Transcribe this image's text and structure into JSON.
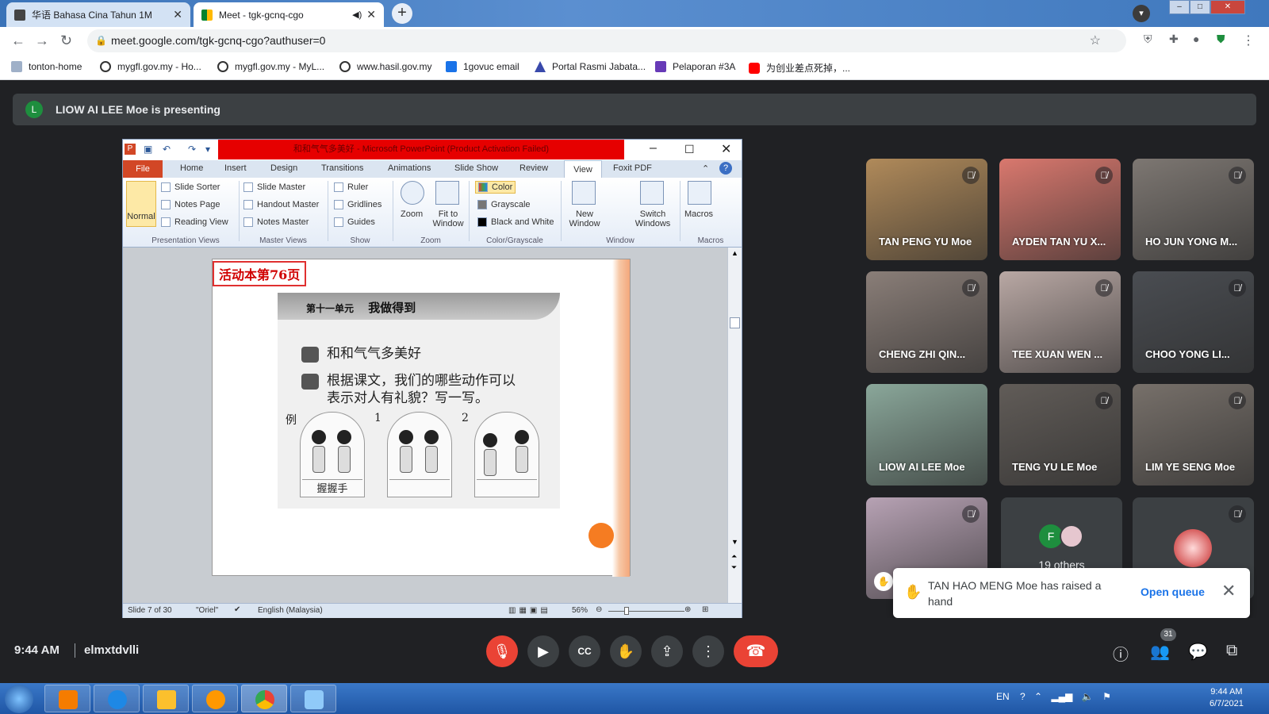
{
  "browser": {
    "tabs": [
      {
        "title": "华语 Bahasa Cina Tahun 1M",
        "active": false
      },
      {
        "title": "Meet - tgk-gcnq-cgo",
        "active": true
      }
    ],
    "url": "meet.google.com/tgk-gcnq-cgo?authuser=0",
    "bookmarks": [
      "tonton-home",
      "mygfl.gov.my - Ho...",
      "mygfl.gov.my - MyL...",
      "www.hasil.gov.my",
      "1govuc email",
      "Portal Rasmi Jabata...",
      "Pelaporan #3A",
      "为创业差点死掉，..."
    ]
  },
  "meet": {
    "presenter_initial": "L",
    "presenting_text": "LIOW AI LEE Moe is presenting",
    "time": "9:44 AM",
    "meeting_code": "elmxtdvlli",
    "participant_count": "31",
    "others_text": "19 others",
    "others_avatar": "F",
    "toast": {
      "message": "TAN HAO MENG Moe has raised a hand",
      "action": "Open queue"
    },
    "tiles": [
      {
        "name": "TAN PENG YU Moe",
        "color": "#b08a5a"
      },
      {
        "name": "AYDEN TAN YU X...",
        "color": "#d9786e"
      },
      {
        "name": "HO JUN YONG M...",
        "color": "#7d7772"
      },
      {
        "name": "CHENG ZHI QIN...",
        "color": "#8a7e78"
      },
      {
        "name": "TEE XUAN WEN ...",
        "color": "#b9a8a4"
      },
      {
        "name": "CHOO YONG LI...",
        "color": "#4a4d52"
      },
      {
        "name": "LIOW AI LEE Moe",
        "color": "#8aa79a"
      },
      {
        "name": "TENG YU LE Moe",
        "color": "#615c58"
      },
      {
        "name": "LIM YE SENG Moe",
        "color": "#77706a"
      },
      {
        "name": "",
        "color": "#b7a2b4"
      }
    ]
  },
  "ppt": {
    "title": "和和气气多美好 - Microsoft PowerPoint (Product Activation Failed)",
    "tabs": [
      "File",
      "Home",
      "Insert",
      "Design",
      "Transitions",
      "Animations",
      "Slide Show",
      "Review",
      "View",
      "Foxit PDF"
    ],
    "ribbon": {
      "normal": "Normal",
      "presentation_views": [
        "Slide Sorter",
        "Notes Page",
        "Reading View"
      ],
      "master_views": [
        "Slide Master",
        "Handout Master",
        "Notes Master"
      ],
      "show": [
        "Ruler",
        "Gridlines",
        "Guides"
      ],
      "zoom": "Zoom",
      "fit": "Fit to Window",
      "color": [
        "Color",
        "Grayscale",
        "Black and White"
      ],
      "new_window": "New Window",
      "switch_windows": "Switch Windows",
      "macros": "Macros",
      "groups": [
        "Presentation Views",
        "Master Views",
        "Show",
        "Zoom",
        "Color/Grayscale",
        "Window",
        "Macros"
      ]
    },
    "slide": {
      "tag": "活动本第76页",
      "unit": "第十一单元",
      "unit_title": "我做得到",
      "line1": "和和气气多美好",
      "line2a": "根据课文，我们的哪些动作可以",
      "line2b": "表示对人有礼貌？写一写。",
      "example_label": "例",
      "panel_nums": [
        "1",
        "2"
      ],
      "example_answer": "握握手"
    },
    "status": {
      "slide": "Slide 7 of 30",
      "theme": "\"Oriel\"",
      "language": "English (Malaysia)",
      "zoom": "56%"
    }
  },
  "taskbar": {
    "lang": "EN",
    "time": "9:44 AM",
    "date": "6/7/2021"
  }
}
